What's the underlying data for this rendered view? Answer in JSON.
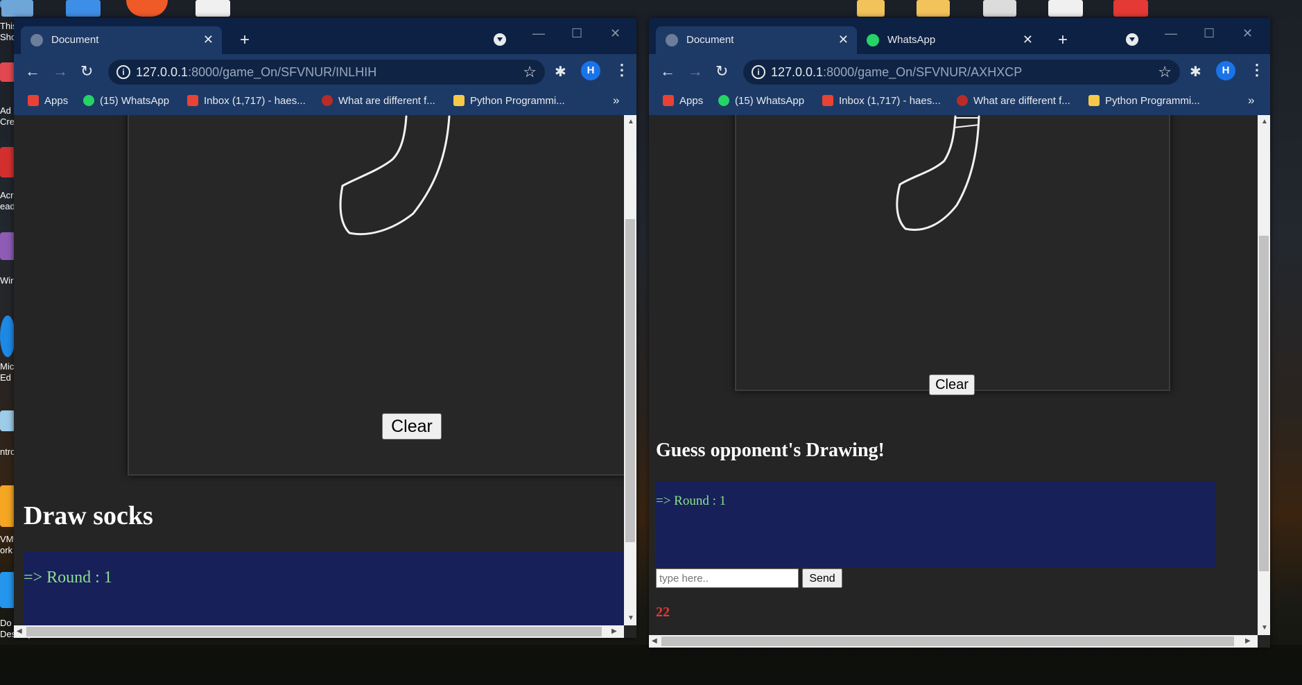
{
  "desktop": {
    "icons": [
      {
        "label": "This\nSho"
      },
      {
        "label": "Ad\nCre"
      },
      {
        "label": "Acr\nead"
      },
      {
        "label": "Wir"
      },
      {
        "label": "Micr\nEd"
      },
      {
        "label": "ntro"
      },
      {
        "label": "VMw\nork"
      },
      {
        "label": "Do\nDesktop"
      }
    ]
  },
  "left_window": {
    "tabs": [
      {
        "label": "Document",
        "close": "✕"
      }
    ],
    "new_tab": "+",
    "url_host": "127.0.0.1",
    "url_path": ":8000/game_On/SFVNUR/INLHIH",
    "profile_initial": "H",
    "bookmarks": [
      {
        "label": "Apps",
        "color": "#e94235"
      },
      {
        "label": "(15) WhatsApp",
        "color": "#25d366"
      },
      {
        "label": "Inbox (1,717) - haes...",
        "color": "#ea4335"
      },
      {
        "label": "What are different f...",
        "color": "#b92b27"
      },
      {
        "label": "Python Programmi...",
        "color": "#f7c948"
      }
    ],
    "more": "»",
    "clear_label": "Clear",
    "heading": "Draw socks",
    "chat": [
      "=> Round : 1"
    ]
  },
  "right_window": {
    "tabs": [
      {
        "label": "Document",
        "close": "✕"
      },
      {
        "label": "WhatsApp",
        "close": "✕"
      }
    ],
    "new_tab": "+",
    "url_host": "127.0.0.1",
    "url_path": ":8000/game_On/SFVNUR/AXHXCP",
    "profile_initial": "H",
    "bookmarks": [
      {
        "label": "Apps",
        "color": "#e94235"
      },
      {
        "label": "(15) WhatsApp",
        "color": "#25d366"
      },
      {
        "label": "Inbox (1,717) - haes...",
        "color": "#ea4335"
      },
      {
        "label": "What are different f...",
        "color": "#b92b27"
      },
      {
        "label": "Python Programmi...",
        "color": "#f7c948"
      }
    ],
    "more": "»",
    "clear_label": "Clear",
    "heading": "Guess opponent's Drawing!",
    "chat": [
      "=> Round : 1"
    ],
    "input_placeholder": "type here..",
    "send_label": "Send",
    "timer": "22"
  },
  "colors": {
    "tabbar": "#0d2144",
    "toolbar": "#1d3a66",
    "page_bg": "#252525",
    "chat_bg": "#18205a",
    "chat_text": "#8ce08c",
    "timer": "#e53935"
  }
}
